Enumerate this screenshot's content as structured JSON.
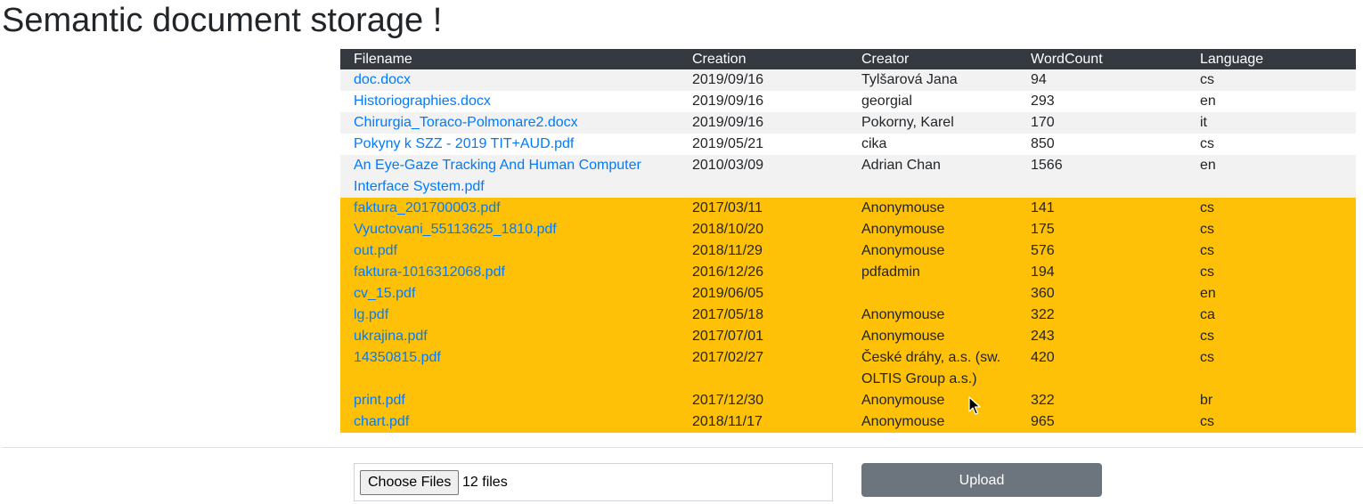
{
  "page": {
    "title": "Semantic document storage !"
  },
  "table": {
    "headers": [
      "Filename",
      "Creation",
      "Creator",
      "WordCount",
      "Language"
    ],
    "rows": [
      {
        "filename": "doc.docx",
        "creation": "2019/09/16",
        "creator": "Tylšarová Jana",
        "wordcount": "94",
        "language": "cs",
        "style": "odd"
      },
      {
        "filename": "Historiographies.docx",
        "creation": "2019/09/16",
        "creator": "georgial",
        "wordcount": "293",
        "language": "en",
        "style": "even"
      },
      {
        "filename": "Chirurgia_Toraco-Polmonare2.docx",
        "creation": "2019/09/16",
        "creator": "Pokorny, Karel",
        "wordcount": "170",
        "language": "it",
        "style": "odd"
      },
      {
        "filename": "Pokyny k SZZ - 2019 TIT+AUD.pdf",
        "creation": "2019/05/21",
        "creator": "cika",
        "wordcount": "850",
        "language": "cs",
        "style": "even"
      },
      {
        "filename": "An Eye-Gaze Tracking And Human Computer Interface System.pdf",
        "creation": "2010/03/09",
        "creator": "Adrian Chan",
        "wordcount": "1566",
        "language": "en",
        "style": "odd"
      },
      {
        "filename": "faktura_201700003.pdf",
        "creation": "2017/03/11",
        "creator": "Anonymouse",
        "wordcount": "141",
        "language": "cs",
        "style": "warning"
      },
      {
        "filename": "Vyuctovani_55113625_1810.pdf",
        "creation": "2018/10/20",
        "creator": "Anonymouse",
        "wordcount": "175",
        "language": "cs",
        "style": "warning"
      },
      {
        "filename": "out.pdf",
        "creation": "2018/11/29",
        "creator": "Anonymouse",
        "wordcount": "576",
        "language": "cs",
        "style": "warning"
      },
      {
        "filename": "faktura-1016312068.pdf",
        "creation": "2016/12/26",
        "creator": "pdfadmin",
        "wordcount": "194",
        "language": "cs",
        "style": "warning"
      },
      {
        "filename": "cv_15.pdf",
        "creation": "2019/06/05",
        "creator": "",
        "wordcount": "360",
        "language": "en",
        "style": "warning"
      },
      {
        "filename": "lg.pdf",
        "creation": "2017/05/18",
        "creator": "Anonymouse",
        "wordcount": "322",
        "language": "ca",
        "style": "warning"
      },
      {
        "filename": "ukrajina.pdf",
        "creation": "2017/07/01",
        "creator": "Anonymouse",
        "wordcount": "243",
        "language": "cs",
        "style": "warning"
      },
      {
        "filename": "14350815.pdf",
        "creation": "2017/02/27",
        "creator": "České dráhy, a.s. (sw. OLTIS Group a.s.)",
        "wordcount": "420",
        "language": "cs",
        "style": "warning"
      },
      {
        "filename": "print.pdf",
        "creation": "2017/12/30",
        "creator": "Anonymouse",
        "wordcount": "322",
        "language": "br",
        "style": "warning"
      },
      {
        "filename": "chart.pdf",
        "creation": "2018/11/17",
        "creator": "Anonymouse",
        "wordcount": "965",
        "language": "cs",
        "style": "warning"
      }
    ]
  },
  "upload_form": {
    "choose_files_label": "Choose Files",
    "file_count": "12 files",
    "upload_label": "Upload"
  },
  "colors": {
    "header_bg": "#343a40",
    "link": "#007bff",
    "warning_row": "#ffc107",
    "upload_button": "#6c757d"
  }
}
